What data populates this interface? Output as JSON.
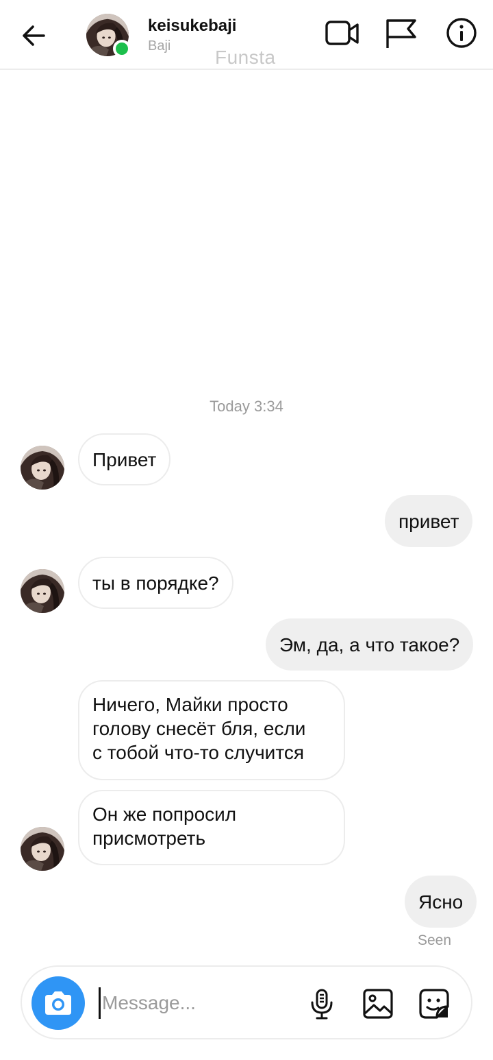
{
  "header": {
    "username": "keisukebaji",
    "display_name": "Baji",
    "watermark": "Funsta",
    "online_color": "#1cbf4c",
    "icons": [
      "back-arrow-icon",
      "video-call-icon",
      "flag-icon",
      "info-icon"
    ]
  },
  "conversation": {
    "timestamp": "Today 3:34",
    "messages": [
      {
        "from": "them",
        "text": "Привет"
      },
      {
        "from": "me",
        "text": "привет"
      },
      {
        "from": "them",
        "text": "ты в порядке?"
      },
      {
        "from": "me",
        "text": "Эм, да, а что такое?"
      },
      {
        "from": "them",
        "lines": [
          "Ничего, Майки просто",
          "голову снесёт бля, если",
          "с тобой что-то случится"
        ]
      },
      {
        "from": "them",
        "lines": [
          "Он же попросил",
          "присмотреть"
        ]
      },
      {
        "from": "me",
        "text": "Ясно"
      }
    ],
    "seen_label": "Seen"
  },
  "composer": {
    "placeholder": "Message...",
    "value": "",
    "accent": "#2f95f5",
    "icons": [
      "camera-icon",
      "microphone-icon",
      "gallery-icon",
      "sticker-icon"
    ]
  }
}
